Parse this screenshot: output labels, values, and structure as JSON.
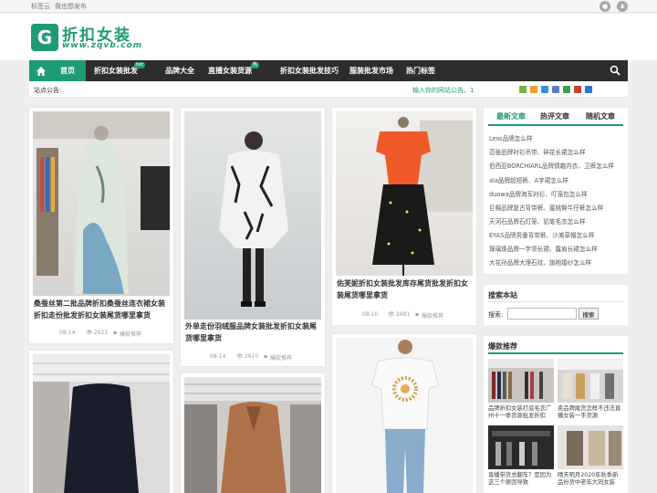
{
  "topbar": {
    "links": [
      "标签云",
      "我也想发布"
    ]
  },
  "header": {
    "logo_glyph": "G",
    "logo_text": "折扣女装",
    "logo_domain": "www.zqvb.com"
  },
  "nav": {
    "items": [
      "首页",
      "折扣女装批发",
      "品牌大全",
      "直播女装货源",
      "折扣女装批发技巧",
      "服装批发市场",
      "热门标签"
    ],
    "badges": [
      "hot",
      "热"
    ]
  },
  "notice": {
    "label": "站点公告:",
    "text": "输入你的网站公告。1"
  },
  "articles": [
    {
      "title": "桑蚕丝第二批品牌折扣桑蚕丝连衣裙女装折扣走份批发折扣女装尾货哪里拿货",
      "date": "08-14",
      "views": "2621",
      "tag": "爆款推荐"
    },
    {
      "title": "外单走份羽绒服品牌女装批发折扣女装尾货哪里拿货",
      "date": "08-14",
      "views": "2610",
      "tag": "爆款推荐"
    },
    {
      "title": "佑芙妮折扣女装批发库存尾货批发折扣女装尾货哪里拿货",
      "date": "08-10",
      "views": "2681",
      "tag": "爆款推荐"
    }
  ],
  "sidebar": {
    "tabs": [
      "最新文章",
      "热评文章",
      "随机文章"
    ],
    "items": [
      "Less品牌怎么样",
      "范鉴品牌衬衫吊带、碎花长裙怎么样",
      "伯西亚BORCHIARL品牌情趣内衣、卫裤怎么样",
      "ala品牌超短裤、A字裙怎么样",
      "duowa品牌海军衬衫、叮笼包怎么样",
      "巨棉品牌复古背带裤、蜜桃臀牛仔裤怎么样",
      "天河石品牌石灯笼、铅笔毛衣怎么样",
      "EYAS品牌男童背带裤、沙滩草帽怎么样",
      "琢璃珠品牌一字领长裙、露肩长裙怎么样",
      "大花孙品牌大理石纹、旗袍婚纱怎么样"
    ],
    "search": {
      "title": "搜索本站",
      "label": "搜索:",
      "placeholder": "",
      "button": "搜索"
    },
    "hot": {
      "title": "爆款推荐",
      "captions": [
        "品牌折扣女装打底毛衣广州十一季货源批发折扣",
        "卖品牌尾货怎样不违法直播女装一手货源",
        "直播带货总翻车？是因为这三个原因导致",
        "晴天明月2020年秋季新品份货中老年大码女装"
      ]
    }
  },
  "colors": {
    "accent": "#1e9b76",
    "nav_bg": "#2d2d2d"
  },
  "icons": [
    "location-icon",
    "user-icon",
    "home-icon",
    "search-icon",
    "eye-icon",
    "tag-icon",
    "calendar-icon"
  ]
}
